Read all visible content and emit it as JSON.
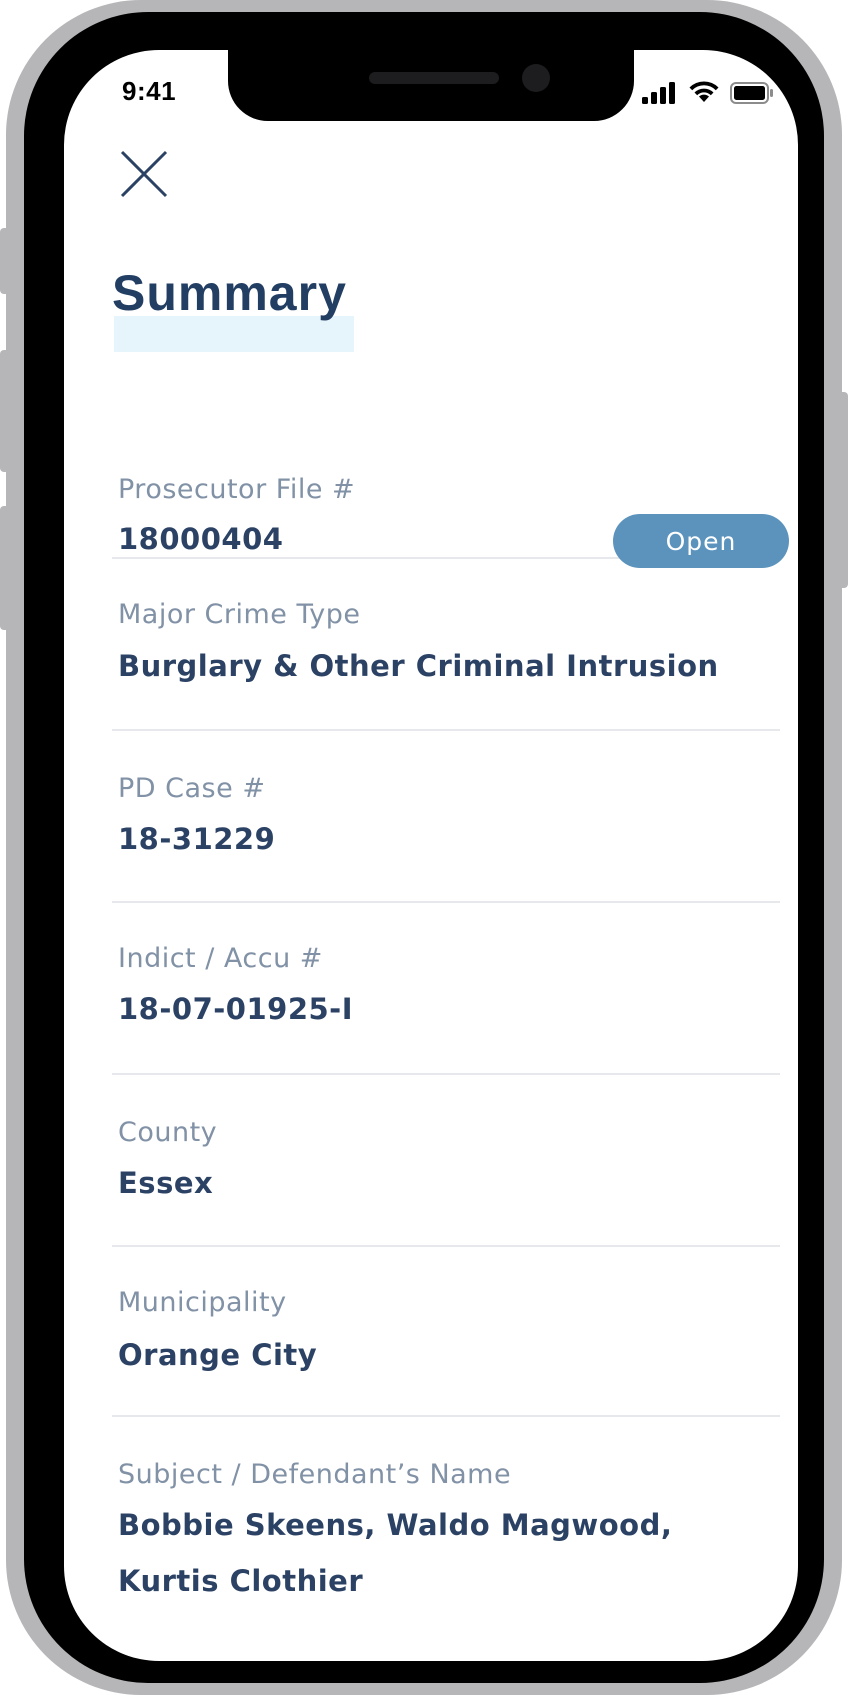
{
  "status_bar": {
    "time": "9:41"
  },
  "header": {
    "close_icon": "close-icon",
    "title": "Summary"
  },
  "fields": [
    {
      "label": "Prosecutor File #",
      "value": "18000404",
      "action_label": "Open"
    },
    {
      "label": "Major Crime Type",
      "value": "Burglary & Other Criminal Intrusion"
    },
    {
      "label": "PD Case #",
      "value": "18-31229"
    },
    {
      "label": "Indict / Accu #",
      "value": "18-07-01925-I"
    },
    {
      "label": "County",
      "value": "Essex"
    },
    {
      "label": "Municipality",
      "value": "Orange City"
    },
    {
      "label": "Subject / Defendant’s Name",
      "value": "Bobbie Skeens, Waldo Magwood, Kurtis Clothier"
    }
  ],
  "colors": {
    "title": "#223e63",
    "label": "#8191a6",
    "value": "#2b4265",
    "accent_button": "#5b93bd",
    "title_highlight": "#e6f4fc",
    "divider": "#e6e8ec"
  }
}
